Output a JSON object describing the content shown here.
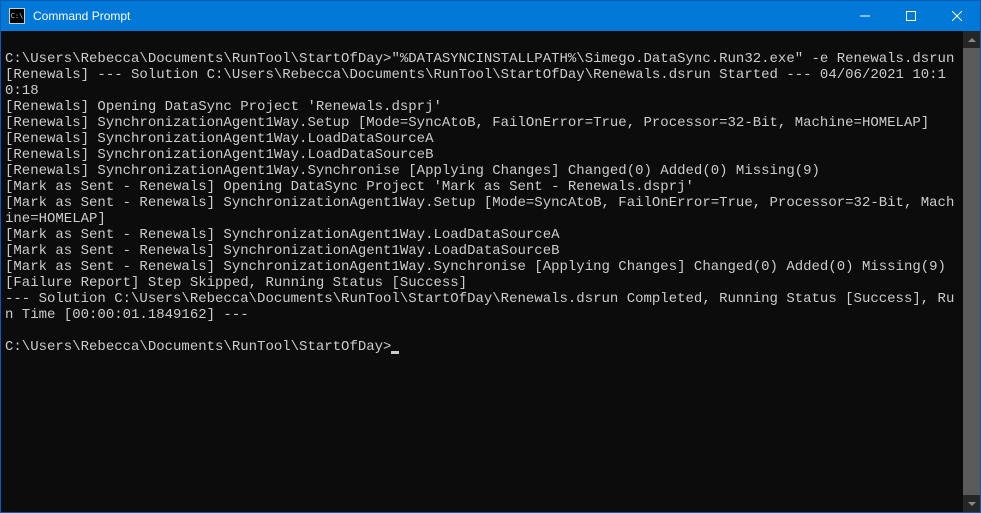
{
  "window": {
    "title": "Command Prompt",
    "icon_label": "C:\\"
  },
  "terminal": {
    "lines": [
      "C:\\Users\\Rebecca\\Documents\\RunTool\\StartOfDay>\"%DATASYNCINSTALLPATH%\\Simego.DataSync.Run32.exe\" -e Renewals.dsrun",
      "[Renewals] --- Solution C:\\Users\\Rebecca\\Documents\\RunTool\\StartOfDay\\Renewals.dsrun Started --- 04/06/2021 10:10:18",
      "[Renewals] Opening DataSync Project 'Renewals.dsprj'",
      "[Renewals] SynchronizationAgent1Way.Setup [Mode=SyncAtoB, FailOnError=True, Processor=32-Bit, Machine=HOMELAP]",
      "[Renewals] SynchronizationAgent1Way.LoadDataSourceA",
      "[Renewals] SynchronizationAgent1Way.LoadDataSourceB",
      "[Renewals] SynchronizationAgent1Way.Synchronise [Applying Changes] Changed(0) Added(0) Missing(9)",
      "[Mark as Sent - Renewals] Opening DataSync Project 'Mark as Sent - Renewals.dsprj'",
      "[Mark as Sent - Renewals] SynchronizationAgent1Way.Setup [Mode=SyncAtoB, FailOnError=True, Processor=32-Bit, Machine=HOMELAP]",
      "[Mark as Sent - Renewals] SynchronizationAgent1Way.LoadDataSourceA",
      "[Mark as Sent - Renewals] SynchronizationAgent1Way.LoadDataSourceB",
      "[Mark as Sent - Renewals] SynchronizationAgent1Way.Synchronise [Applying Changes] Changed(0) Added(0) Missing(9)",
      "[Failure Report] Step Skipped, Running Status [Success]",
      "--- Solution C:\\Users\\Rebecca\\Documents\\RunTool\\StartOfDay\\Renewals.dsrun Completed, Running Status [Success], Run Time [00:00:01.1849162] ---",
      "",
      "C:\\Users\\Rebecca\\Documents\\RunTool\\StartOfDay>"
    ]
  }
}
